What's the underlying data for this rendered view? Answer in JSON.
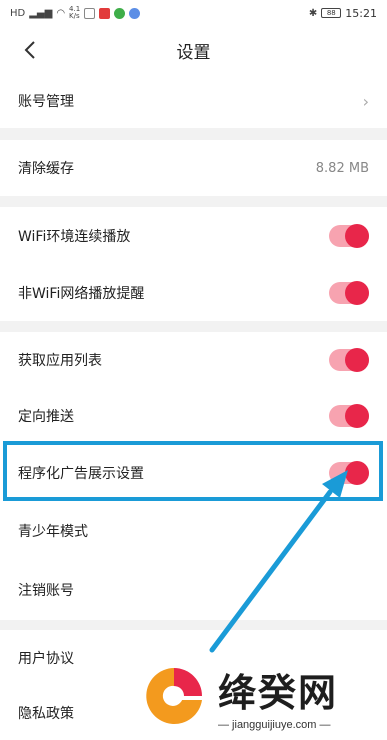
{
  "status_bar": {
    "left_label": "HD",
    "net_speed_top": "4.1",
    "net_speed_bottom": "K/s",
    "battery": "88",
    "time": "15:21"
  },
  "header": {
    "title": "设置"
  },
  "rows": {
    "account": "账号管理",
    "clear_cache": "清除缓存",
    "cache_size": "8.82 MB",
    "wifi_autoplay": "WiFi环境连续播放",
    "non_wifi_reminder": "非WiFi网络播放提醒",
    "app_list": "获取应用列表",
    "targeted_push": "定向推送",
    "programmatic_ads": "程序化广告展示设置",
    "youth_mode": "青少年模式",
    "cancel_account": "注销账号",
    "user_agreement": "用户协议",
    "privacy_policy": "隐私政策"
  },
  "toggles": {
    "wifi_autoplay": true,
    "non_wifi_reminder": true,
    "app_list": true,
    "targeted_push": true,
    "programmatic_ads": true
  },
  "watermark": {
    "title": "绛癸网",
    "url": "— jiangguijiuye.com —"
  },
  "colors": {
    "accent": "#e8264a",
    "toggle_track": "#f7a3b0",
    "highlight": "#1a9bd7",
    "background": "#f2f2f2"
  }
}
